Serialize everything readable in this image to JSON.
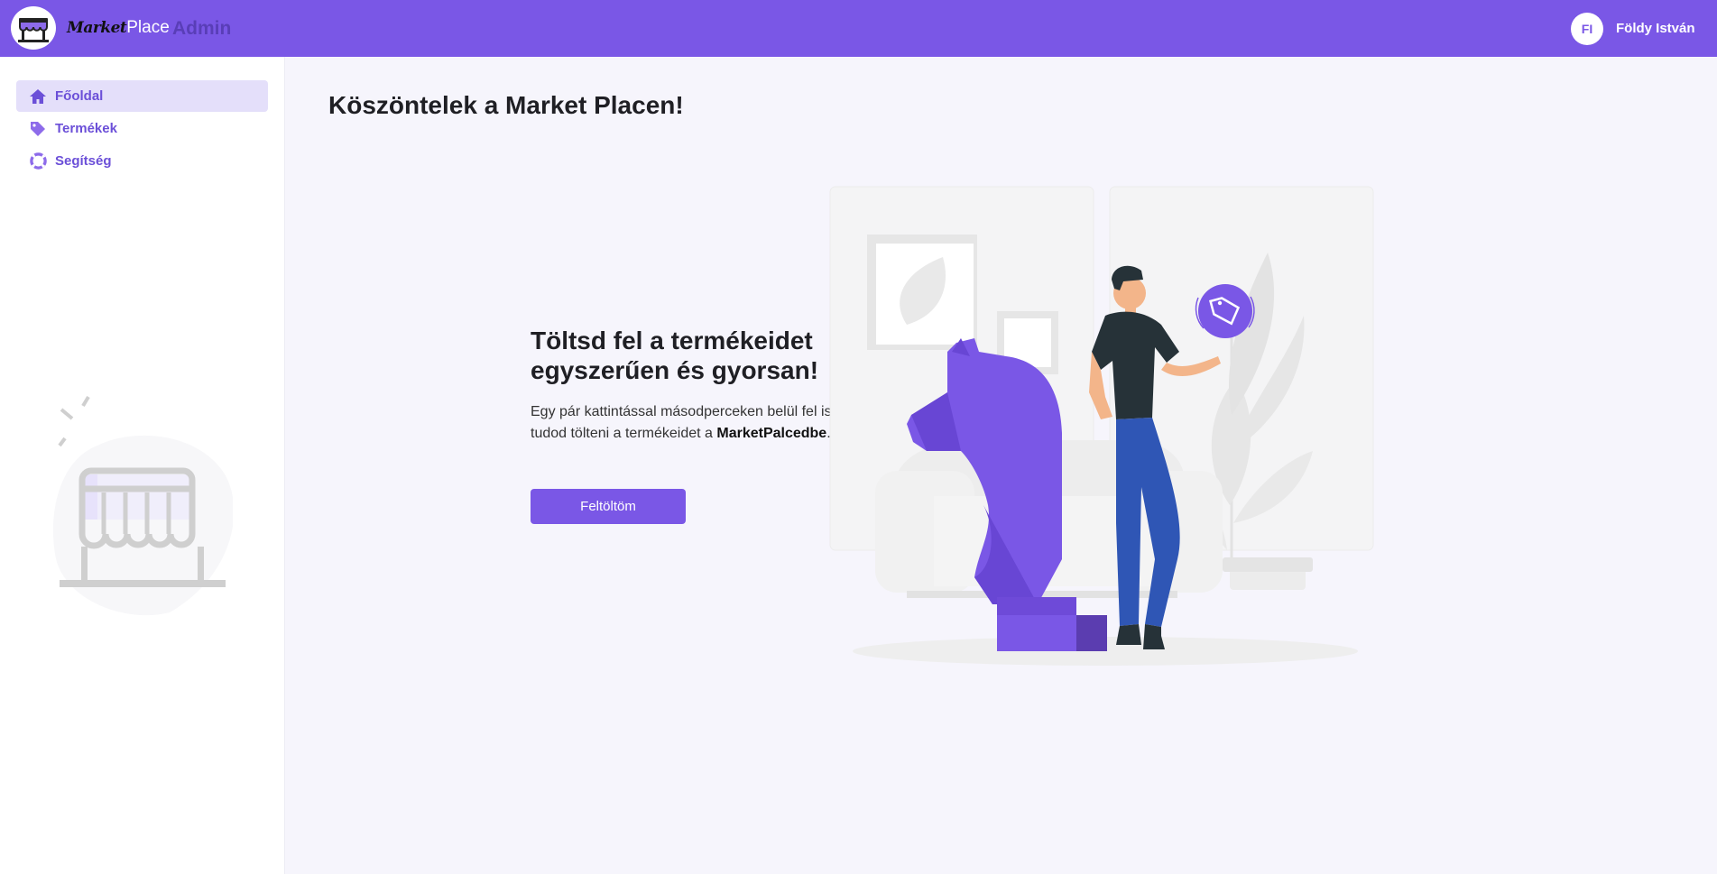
{
  "header": {
    "brand_part1": "Market",
    "brand_part2": "Place",
    "admin_label": "Admin",
    "user_initials": "FI",
    "user_name": "Földy István"
  },
  "sidebar": {
    "items": [
      {
        "label": "Főoldal",
        "icon": "home-icon",
        "active": true
      },
      {
        "label": "Termékek",
        "icon": "tag-icon",
        "active": false
      },
      {
        "label": "Segítség",
        "icon": "lifebuoy-icon",
        "active": false
      }
    ]
  },
  "main": {
    "title": "Köszöntelek a Market Placen!",
    "hero_title": "Töltsd fel a termékeidet egyszerűen és gyorsan!",
    "hero_text_prefix": "Egy pár kattintással másodperceken belül fel is tudod tölteni a termékeidet a ",
    "hero_text_brand": "MarketPalcedbe",
    "hero_text_suffix": ".",
    "upload_button": "Feltöltöm"
  },
  "colors": {
    "accent": "#7a57e6",
    "active_nav_bg": "#e4dffa",
    "background": "#f6f5fc"
  }
}
